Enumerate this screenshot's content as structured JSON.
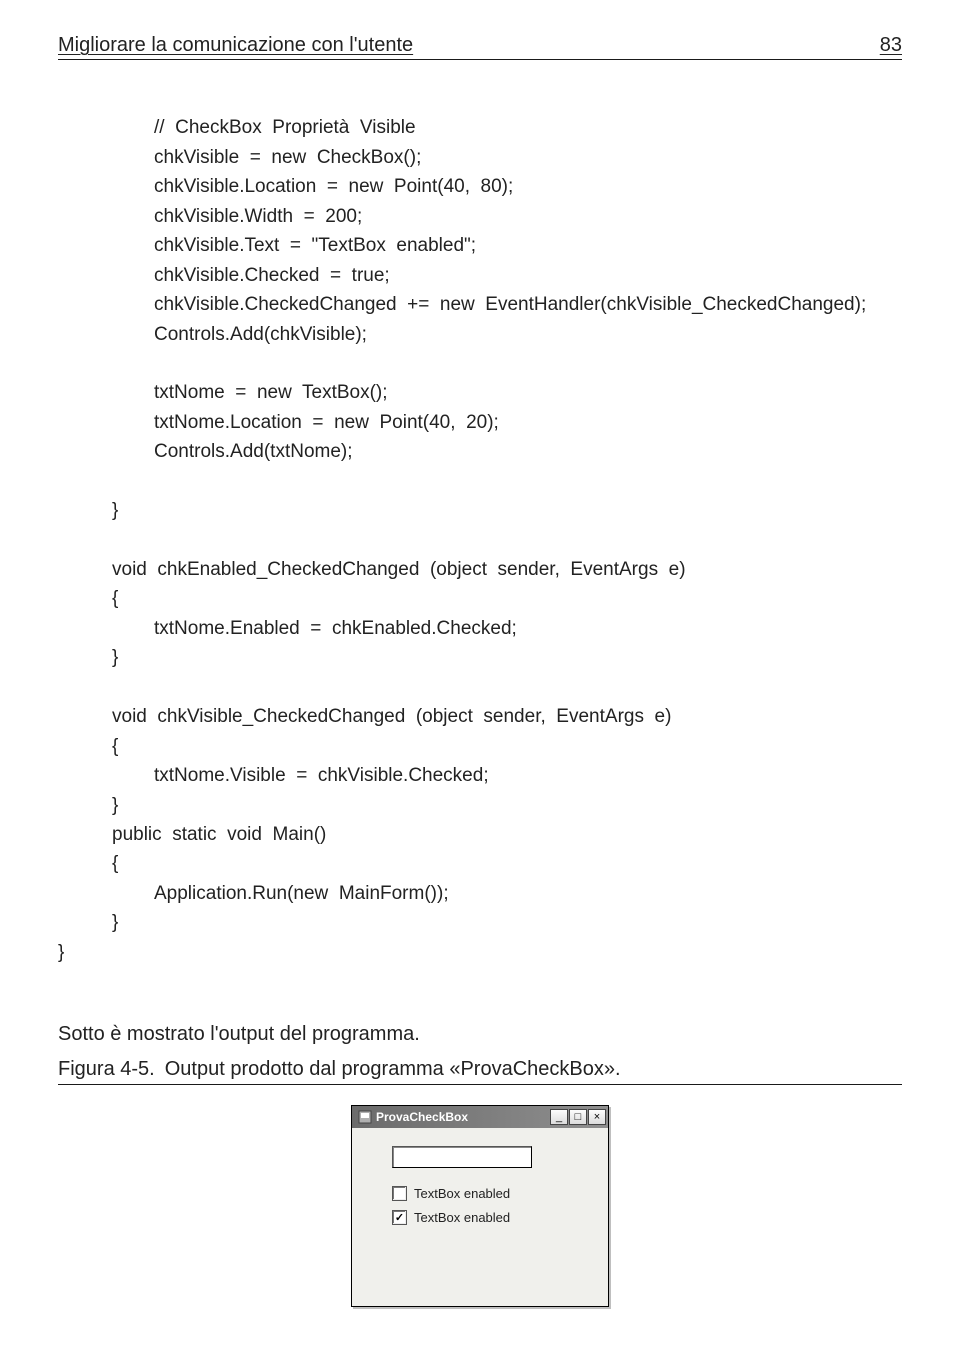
{
  "header": {
    "title": "Migliorare la comunicazione con l'utente",
    "page": "83"
  },
  "code": [
    "//  CheckBox  Proprietà  Visible",
    "chkVisible  =  new  CheckBox();",
    "chkVisible.Location  =  new  Point(40,  80);",
    "chkVisible.Width  =  200;",
    "chkVisible.Text  =  \"TextBox  enabled\";",
    "chkVisible.Checked  =  true;",
    "chkVisible.CheckedChanged  +=  new  EventHandler(chkVisible_CheckedChanged);",
    "Controls.Add(chkVisible);",
    "",
    "txtNome  =  new  TextBox();",
    "txtNome.Location  =  new  Point(40,  20);",
    "Controls.Add(txtNome);",
    "",
    "}",
    "",
    "void  chkEnabled_CheckedChanged  (object  sender,  EventArgs  e)",
    "{",
    "txtNome.Enabled  =  chkEnabled.Checked;",
    "}",
    "",
    "void  chkVisible_CheckedChanged  (object  sender,  EventArgs  e)",
    "{",
    "txtNome.Visible  =  chkVisible.Checked;",
    "}",
    "public  static  void  Main()",
    "{",
    "Application.Run(new  MainForm());",
    "}",
    "}"
  ],
  "text": {
    "intro": "Sotto è mostrato l'output del programma."
  },
  "figure": {
    "label": "Figura 4-5.",
    "title": "Output prodotto dal programma «ProvaCheckBox»."
  },
  "window": {
    "title": "ProvaCheckBox",
    "check1": "TextBox enabled",
    "check2": "TextBox enabled"
  }
}
